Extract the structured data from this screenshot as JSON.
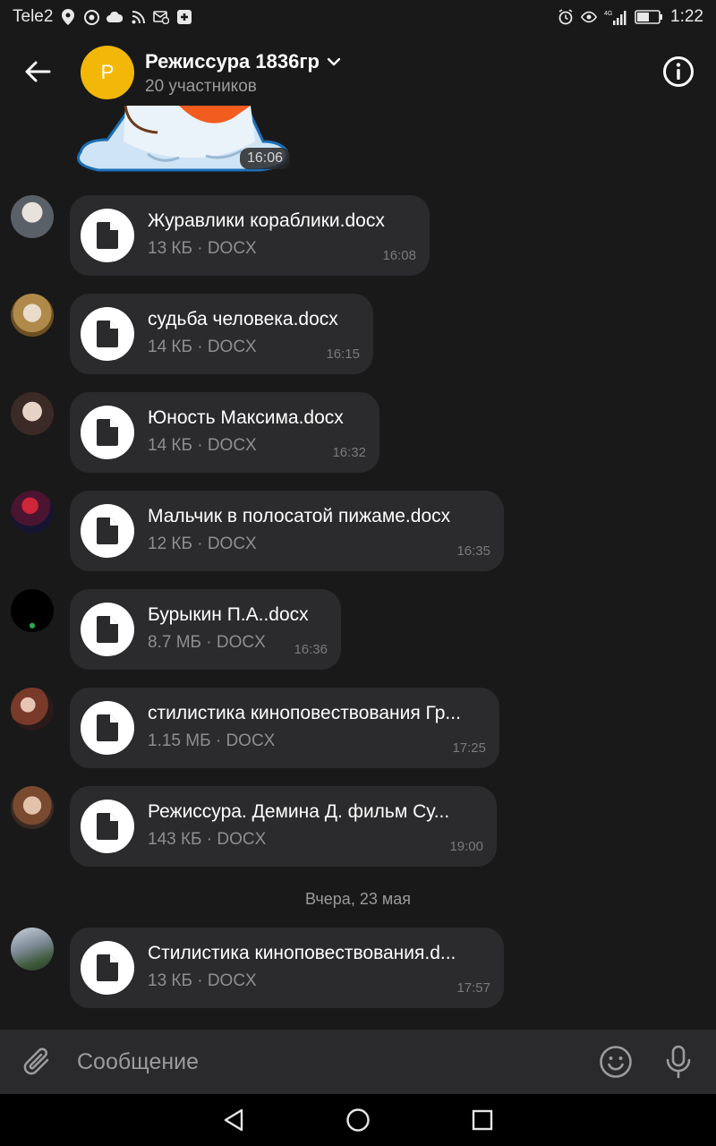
{
  "status": {
    "carrier": "Tele2",
    "network": "4G",
    "time": "1:22"
  },
  "header": {
    "avatar_letter": "P",
    "avatar_color": "#f2b707",
    "title": "Режиссура 1836гр",
    "subtitle": "20 участников"
  },
  "sticker": {
    "time": "16:06"
  },
  "messages": [
    {
      "name": "Журавлики кораблики.docx",
      "meta": "13 КБ · DOCX",
      "time": "16:08"
    },
    {
      "name": "судьба человека.docx",
      "meta": "14 КБ · DOCX",
      "time": "16:15"
    },
    {
      "name": "Юность Максима.docx",
      "meta": "14 КБ · DOCX",
      "time": "16:32"
    },
    {
      "name": "Мальчик в полосатой пижаме.docx",
      "meta": "12 КБ · DOCX",
      "time": "16:35"
    },
    {
      "name": "Бурыкин П.А..docx",
      "meta": "8.7 МБ · DOCX",
      "time": "16:36"
    },
    {
      "name": "стилистика киноповествования Гр...",
      "meta": "1.15 МБ · DOCX",
      "time": "17:25"
    },
    {
      "name": "Режиссура. Демина Д.  фильм Су...",
      "meta": "143 КБ · DOCX",
      "time": "19:00"
    },
    {
      "name": "Стилистика киноповествования.d...",
      "meta": "13 КБ · DOCX",
      "time": "17:57"
    }
  ],
  "date_separator": "Вчера, 23 мая",
  "composer": {
    "placeholder": "Сообщение"
  },
  "colors": {
    "background": "#19191a",
    "bubble": "#2b2b2d",
    "composer": "#2a2a2c"
  }
}
